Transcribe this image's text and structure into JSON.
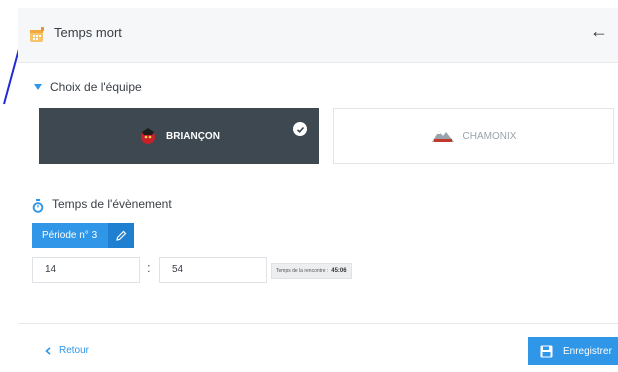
{
  "header": {
    "title": "Temps mort",
    "icon": "calendar-icon",
    "back_icon": "arrow-left-icon"
  },
  "team_section": {
    "title": "Choix de l'équipe",
    "teams": [
      {
        "name": "BRIANÇON",
        "selected": true
      },
      {
        "name": "CHAMONIX",
        "selected": false
      }
    ]
  },
  "time_section": {
    "title": "Temps de l'évènement",
    "period_label": "Période n° 3",
    "minutes": "14",
    "seconds": "54",
    "colon": ":",
    "match_time_label": "Temps de la rencontre :",
    "match_time_value": "45:06"
  },
  "footer": {
    "back_label": "Retour",
    "save_label": "Enregistrer"
  },
  "colors": {
    "accent": "#2f96e8",
    "selected_team_bg": "#3d4850"
  }
}
